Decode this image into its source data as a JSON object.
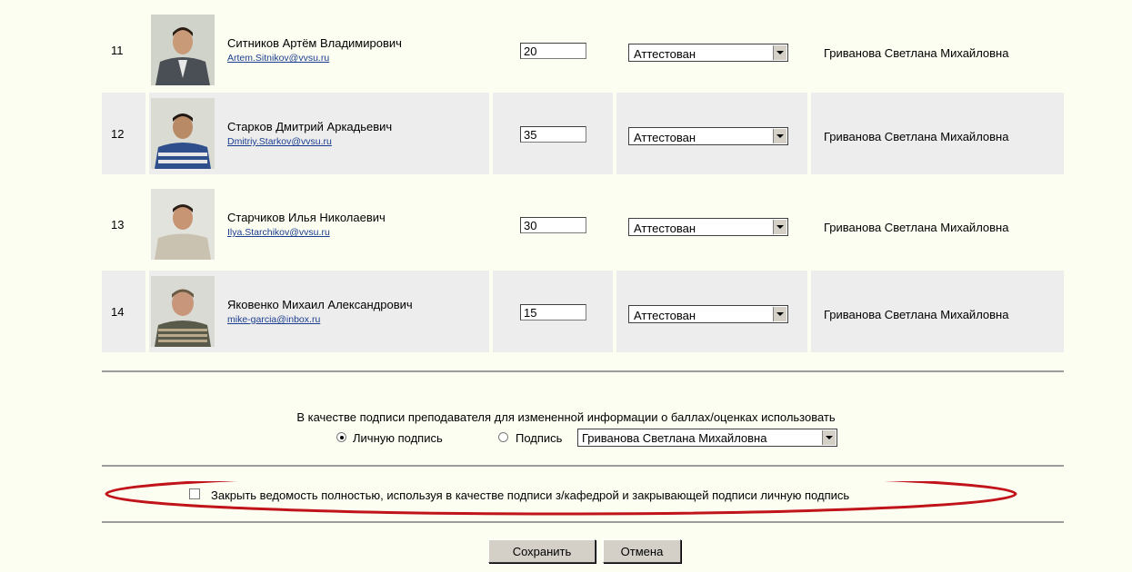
{
  "students": [
    {
      "num": "11",
      "name": "Ситников Артём Владимирович",
      "email": "Artem.Sitnikov@vvsu.ru",
      "score": "20",
      "status": "Аттестован",
      "teacher": "Гриванова Светлана Михайловна"
    },
    {
      "num": "12",
      "name": "Старков Дмитрий Аркадьевич",
      "email": "Dmitriy.Starkov@vvsu.ru",
      "score": "35",
      "status": "Аттестован",
      "teacher": "Гриванова Светлана Михайловна"
    },
    {
      "num": "13",
      "name": "Старчиков Илья Николаевич",
      "email": "Ilya.Starchikov@vvsu.ru",
      "score": "30",
      "status": "Аттестован",
      "teacher": "Гриванова Светлана Михайловна"
    },
    {
      "num": "14",
      "name": "Яковенко Михаил Александрович",
      "email": "mike-garcia@inbox.ru",
      "score": "15",
      "status": "Аттестован",
      "teacher": "Гриванова Светлана Михайловна"
    }
  ],
  "signature": {
    "prompt": "В качестве подписи преподавателя для измененной информации о баллах/оценках использовать",
    "option_personal": "Личную подпись",
    "option_signature": "Подпись",
    "selected_signer": "Гриванова Светлана Михайловна"
  },
  "close_statement": {
    "label": "Закрыть ведомость полностью, используя в качестве подписи з/кафедрой и закрывающей подписи личную подпись",
    "highlight_color": "#c0141a"
  },
  "buttons": {
    "save": "Сохранить",
    "cancel": "Отмена"
  }
}
